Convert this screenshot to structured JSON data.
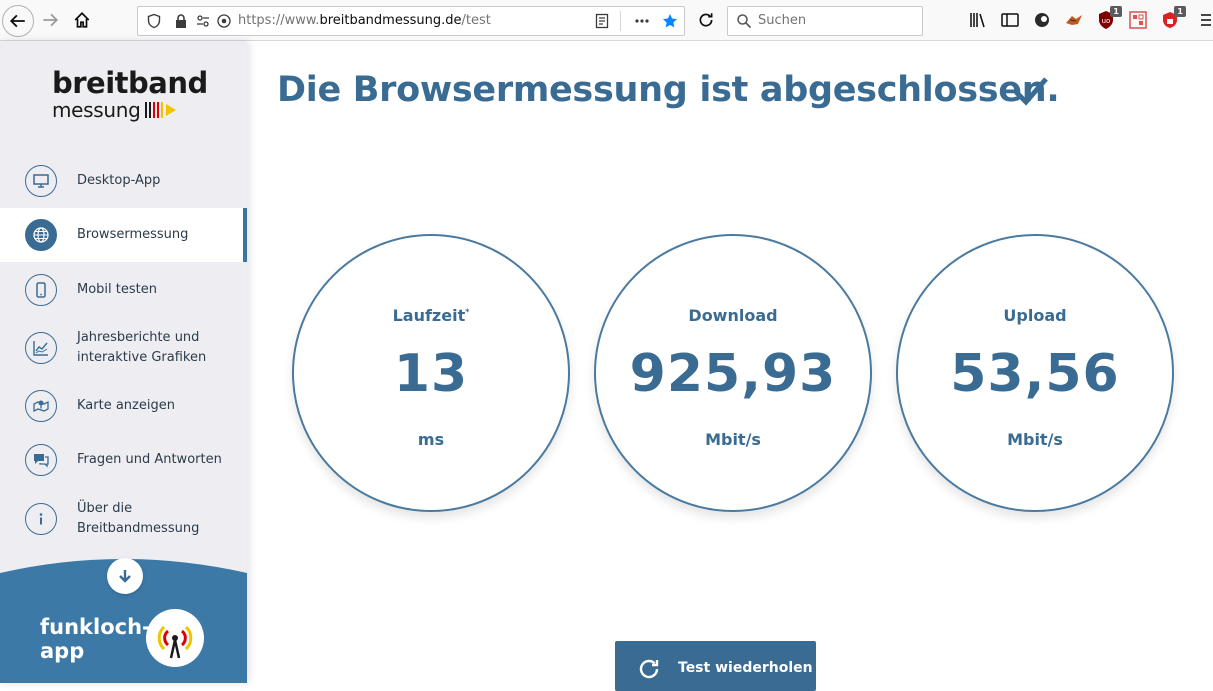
{
  "browser": {
    "url_prefix": "https://www.",
    "url_host": "breitbandmessung.de",
    "url_path": "/test",
    "search_placeholder": "Suchen",
    "ext_badge_1": "1",
    "ext_badge_2": "1"
  },
  "sidebar": {
    "logo_line1": "breitband",
    "logo_line2": "messung",
    "items": [
      {
        "label": "Desktop-App",
        "icon": "monitor-icon"
      },
      {
        "label": "Browsermessung",
        "icon": "globe-icon",
        "active": true
      },
      {
        "label": "Mobil testen",
        "icon": "phone-icon"
      },
      {
        "label": "Jahresberichte und\ninteraktive Grafiken",
        "icon": "chart-icon"
      },
      {
        "label": "Karte anzeigen",
        "icon": "map-icon"
      },
      {
        "label": "Fragen und Antworten",
        "icon": "chat-icon"
      },
      {
        "label": "Über die\nBreitbandmessung",
        "icon": "info-icon"
      }
    ],
    "funkloch_line1": "funkloch-",
    "funkloch_line2": "app"
  },
  "main": {
    "headline": "Die Browsermessung ist abgeschlossen.",
    "gauges": [
      {
        "title": "Laufzeit",
        "sup": "*",
        "value": "13",
        "unit": "ms"
      },
      {
        "title": "Download",
        "value": "925,93",
        "unit": "Mbit/s"
      },
      {
        "title": "Upload",
        "value": "53,56",
        "unit": "Mbit/s"
      }
    ],
    "repeat_label": "Test wiederholen"
  },
  "colors": {
    "accent": "#3a6c93",
    "sidebar_bg": "#eeeef2",
    "funkloch_bg": "#3d79a6"
  }
}
